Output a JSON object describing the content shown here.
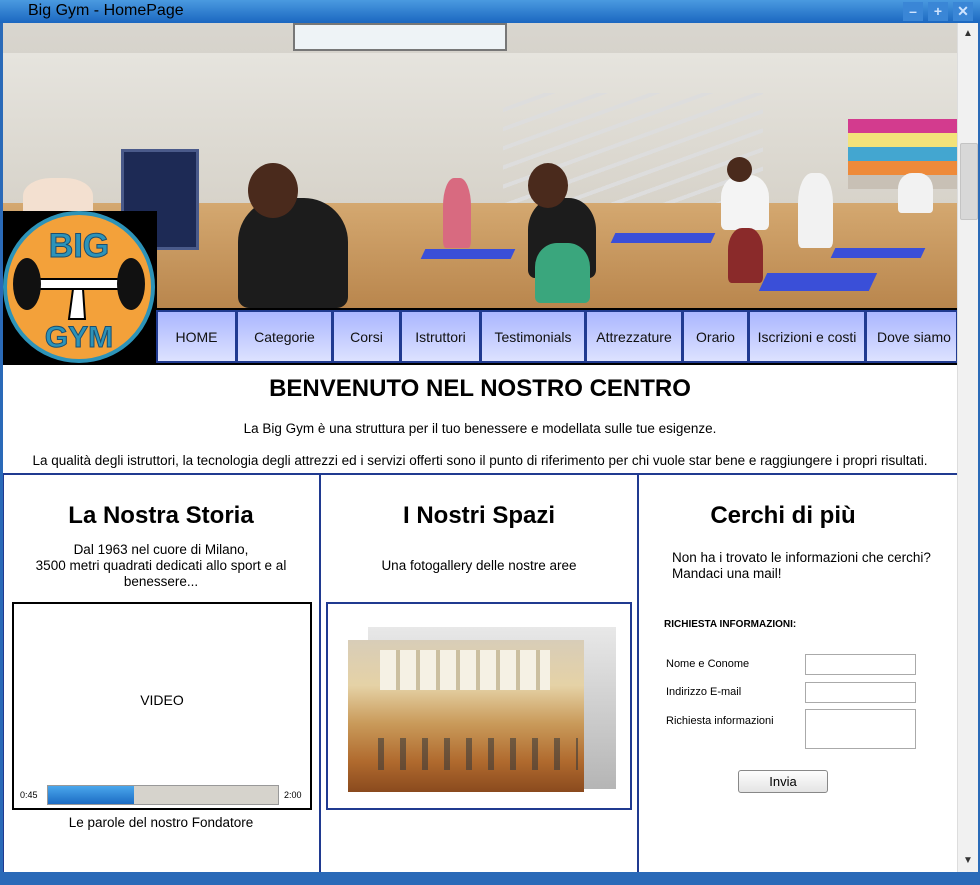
{
  "window": {
    "title": "Big Gym - HomePage",
    "controls": [
      "–",
      "+",
      "✕"
    ]
  },
  "logo": {
    "top_text": "BIG",
    "bottom_text": "GYM"
  },
  "nav": {
    "items": [
      "HOME",
      "Categorie",
      "Corsi",
      "Istruttori",
      "Testimonials",
      "Attrezzature",
      "Orario",
      "Iscrizioni e costi",
      "Dove siamo"
    ]
  },
  "welcome": {
    "title": "BENVENUTO NEL NOSTRO CENTRO",
    "line1": "La Big Gym è una struttura per il tuo benessere e modellata sulle tue esigenze.",
    "line2": "La qualità degli istruttori, la tecnologia degli attrezzi ed i servizi offerti sono il punto di riferimento per chi vuole star bene e raggiungere i propri risultati."
  },
  "storia": {
    "title": "La Nostra Storia",
    "text_line1": "Dal 1963 nel cuore di Milano,",
    "text_line2": "3500 metri quadrati dedicati allo sport e al",
    "text_line3": "benessere...",
    "video_label": "VIDEO",
    "video_current": "0:45",
    "video_total": "2:00",
    "video_progress": 0.375,
    "caption": "Le parole del nostro Fondatore"
  },
  "spazi": {
    "title": "I Nostri Spazi",
    "text": "Una fotogallery delle nostre aree"
  },
  "contatti": {
    "title": "Cerchi di più",
    "text_line1": "Non ha i trovato le informazioni che cerchi?",
    "text_line2": "Mandaci una mail!",
    "form_title": "RICHIESTA INFORMAZIONI:",
    "name_label": "Nome e Conome",
    "email_label": "Indirizzo E-mail",
    "request_label": "Richiesta informazioni",
    "name_value": "",
    "email_value": "",
    "request_value": "",
    "send_label": "Invia"
  },
  "scrollbar": {
    "up": "▲",
    "down": "▼"
  },
  "colors": {
    "accent": "#203a90",
    "titlebar": "#2a6ab8",
    "nav_bg": "#aab6ff",
    "logo_orange": "#f3a13a"
  }
}
